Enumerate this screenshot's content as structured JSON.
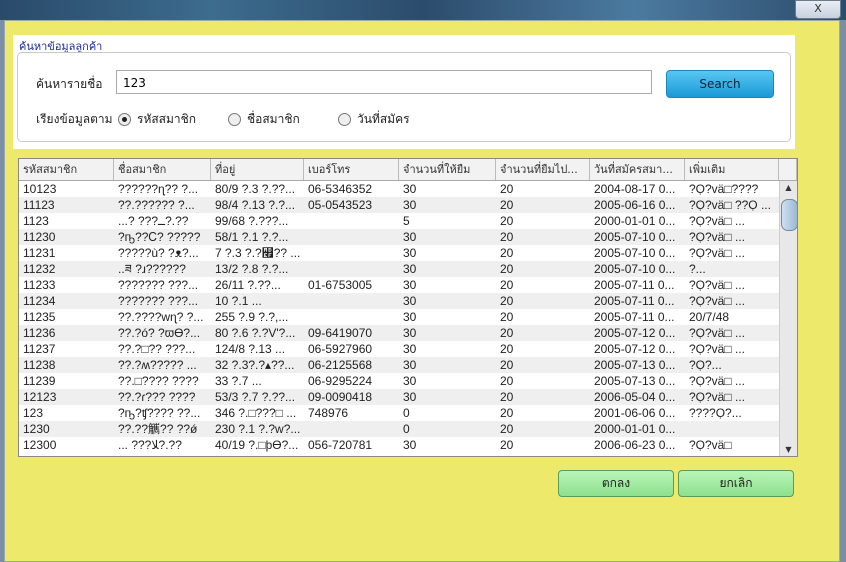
{
  "window": {
    "close_label": "X"
  },
  "search_panel": {
    "title": "ค้นหาข้อมูลลูกค้า",
    "search_label": "ค้นหารายชื่อ",
    "search_value": "123",
    "search_button": "Search",
    "sort_label": "เรียงข้อมูลตาม",
    "sort_options": [
      {
        "label": "รหัสสมาชิก",
        "selected": true
      },
      {
        "label": "ชื่อสมาชิก",
        "selected": false
      },
      {
        "label": "วันที่สมัคร",
        "selected": false
      }
    ]
  },
  "table": {
    "columns": [
      "รหัสสมาชิก",
      "ชื่อสมาชิก",
      "ที่อยู่",
      "เบอร์โทร",
      "จำนวนที่ให้ยืม",
      "จำนวนที่ยืมไป...",
      "วันที่สมัครสมา...",
      "เพิ่มเติม"
    ],
    "rows": [
      [
        "10123",
        "??????ɳ?? ?...",
        "80/9 ?.3 ?.??...",
        "06-5346352",
        "30",
        "20",
        "2004-08-17 0...",
        "?Ọ?vä□????"
      ],
      [
        "11123",
        "??.?????? ?...",
        "98/4 ?.13 ?.?...",
        "05-0543523",
        "30",
        "20",
        "2005-06-16 0...",
        "?Ọ?vä□ ??Ọ ..."
      ],
      [
        "1123",
        "...? ???ــ?.??",
        "99/68 ?.???...",
        "",
        "5",
        "20",
        "2000-01-01 0...",
        "?Ọ?vä□ ..."
      ],
      [
        "11230",
        "?ҧ??Ꮯ? ?????",
        "58/1 ?.1 ?.?...",
        "",
        "30",
        "20",
        "2005-07-10 0...",
        "?Ọ?vä□ ..."
      ],
      [
        "11231",
        "?????ù? ?ᴥ?...",
        "7 ?.3 ?.?꯯?? ...",
        "",
        "30",
        "20",
        "2005-07-10 0...",
        "?Ọ?vä□ ..."
      ],
      [
        "11232",
        "..ཟ ?ɹ??????",
        "13/2 ?.8 ?.?...",
        "",
        "30",
        "20",
        "2005-07-10 0...",
        "?..."
      ],
      [
        "11233",
        "??????? ???...",
        "26/11 ?.??...",
        "01-6753005",
        "30",
        "20",
        "2005-07-11 0...",
        "?Ọ?vä□ ..."
      ],
      [
        "11234",
        "??????? ???...",
        "10 ?.1 ...",
        "",
        "30",
        "20",
        "2005-07-11 0...",
        "?Ọ?vä□ ..."
      ],
      [
        "11235",
        "??.????wɳ? ?...",
        "255 ?.9 ?.?,...",
        "",
        "30",
        "20",
        "2005-07-11 0...",
        "20/7/48"
      ],
      [
        "11236",
        "??.?ó? ?ϖϴ?...",
        "80 ?.6 ?.?V'?...",
        "09-6419070",
        "30",
        "20",
        "2005-07-12 0...",
        "?Ọ?vä□ ..."
      ],
      [
        "11237",
        "??.?□?? ???...",
        "124/8 ?.13 ...",
        "06-5927960",
        "30",
        "20",
        "2005-07-12 0...",
        "?Ọ?vä□ ..."
      ],
      [
        "11238",
        "??.?ʍ????? ...",
        "32 ?.3?.?▴??...",
        "06-2125568",
        "30",
        "20",
        "2005-07-13 0...",
        "?Ọ?..."
      ],
      [
        "11239",
        "??.□???? ????",
        "33 ?.7 ...",
        "06-9295224",
        "30",
        "20",
        "2005-07-13 0...",
        "?Ọ?vä□ ..."
      ],
      [
        "12123",
        "??.?ɾ??? ????",
        "53/3 ?.7 ?.??...",
        "09-0090418",
        "30",
        "20",
        "2006-05-04 0...",
        "?Ọ?vä□ ..."
      ],
      [
        "123",
        "?ҧ?ʧ???? ??...",
        "346 ?.□???□ ...",
        "748976",
        "0",
        "20",
        "2001-06-06 0...",
        "????Ọ?..."
      ],
      [
        "1230",
        "??.??觽?? ??ǿ",
        "230 ?.1 ?.?w?...",
        "",
        "0",
        "20",
        "2000-01-01 0...",
        ""
      ],
      [
        "12300",
        "... ???ﻼ?.??",
        "40/19 ?.□þϴ?...",
        "056-720781",
        "30",
        "20",
        "2006-06-23 0...",
        "?Ọ?vä□"
      ]
    ]
  },
  "buttons": {
    "ok": "ตกลง",
    "cancel": "ยกเลิก"
  }
}
